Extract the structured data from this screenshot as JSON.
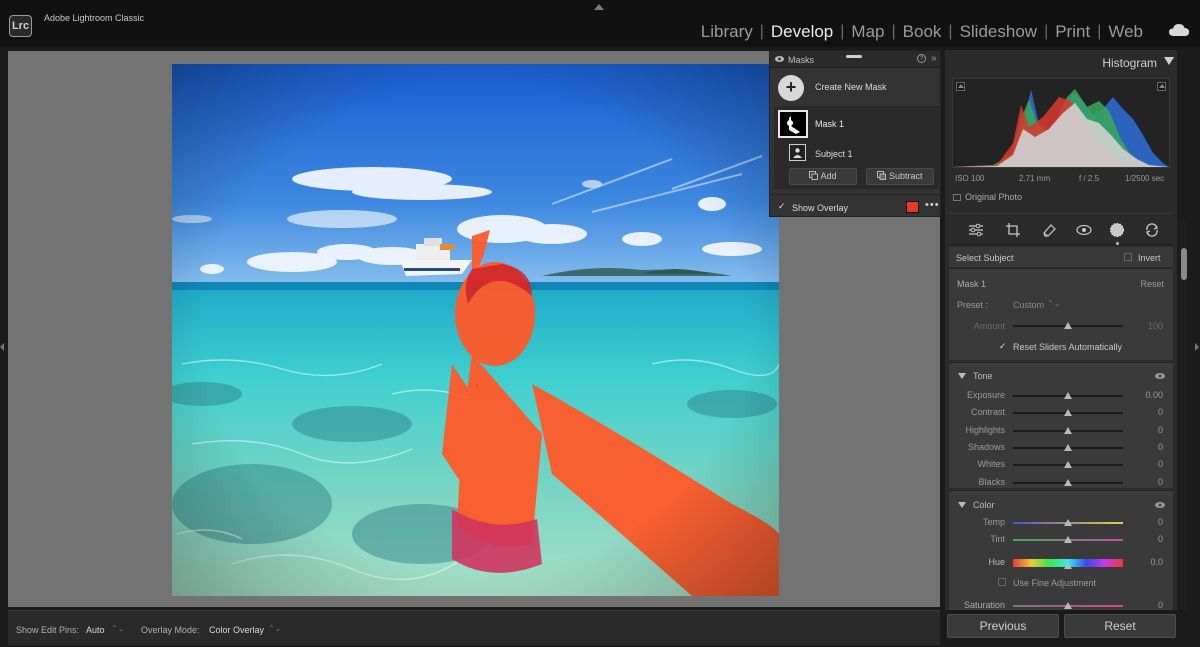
{
  "app": {
    "logo": "Lrc",
    "title": "Adobe Lightroom Classic"
  },
  "modules": [
    "Library",
    "Develop",
    "Map",
    "Book",
    "Slideshow",
    "Print",
    "Web"
  ],
  "active_module": "Develop",
  "icons": {
    "cloud": "cloud-icon",
    "eye": "eye-icon",
    "help": "help-icon",
    "more": "more-icon"
  },
  "masks": {
    "title": "Masks",
    "create_label": "Create New Mask",
    "create_symbol": "+",
    "mask1_label": "Mask 1",
    "subject_label": "Subject 1",
    "add_label": "Add",
    "subtract_label": "Subtract",
    "show_overlay_label": "Show Overlay",
    "show_overlay_checked": true,
    "overlay_color": "#e63a24",
    "collapse_symbol": "»"
  },
  "histogram": {
    "title": "Histogram",
    "iso": "ISO 100",
    "focal": "2.71 mm",
    "aperture": "f / 2.5",
    "shutter": "1/2500 sec",
    "original_photo_label": "Original Photo"
  },
  "mask_panel": {
    "select_subject": "Select Subject",
    "invert": "Invert",
    "mask_name": "Mask 1",
    "reset": "Reset",
    "preset_label": "Preset :",
    "preset_value": "Custom",
    "amount_label": "Amount",
    "amount_value": "100",
    "amount_position": 0.5,
    "reset_sliders_label": "Reset Sliders Automatically",
    "reset_sliders_checked": true
  },
  "tone": {
    "title": "Tone",
    "sliders": [
      {
        "label": "Exposure",
        "value": "0.00",
        "position": 0.5
      },
      {
        "label": "Contrast",
        "value": "0",
        "position": 0.5
      },
      {
        "label": "Highlights",
        "value": "0",
        "position": 0.5
      },
      {
        "label": "Shadows",
        "value": "0",
        "position": 0.5
      },
      {
        "label": "Whites",
        "value": "0",
        "position": 0.5
      },
      {
        "label": "Blacks",
        "value": "0",
        "position": 0.5
      }
    ]
  },
  "color": {
    "title": "Color",
    "sliders": [
      {
        "label": "Temp",
        "value": "0",
        "position": 0.5
      },
      {
        "label": "Tint",
        "value": "0",
        "position": 0.5
      },
      {
        "label": "Hue",
        "value": "0.0",
        "position": 0.5
      }
    ],
    "fine_adjust_label": "Use Fine Adjustment",
    "saturation": {
      "label": "Saturation",
      "value": "0",
      "position": 0.5
    }
  },
  "bottom": {
    "edit_pins_label": "Show Edit Pins:",
    "edit_pins_value": "Auto",
    "overlay_mode_label": "Overlay Mode:",
    "overlay_mode_value": "Color Overlay",
    "stepper_symbol": "⌃⌄"
  },
  "buttons": {
    "previous": "Previous",
    "reset": "Reset"
  }
}
